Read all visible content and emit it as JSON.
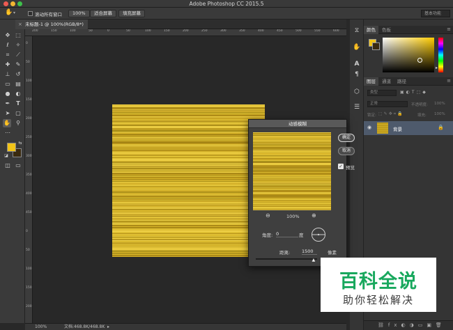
{
  "app": {
    "title": "Adobe Photoshop CC 2015.5"
  },
  "options_bar": {
    "scroll_all_label": "滚动所有窗口",
    "zoom_label": "100%",
    "fit_screen_label": "适合屏幕",
    "fill_screen_label": "填充屏幕",
    "workspace_label": "基本功能"
  },
  "document": {
    "tab_title": "未标题-1 @ 100%(RGB/8*)",
    "tab_close": "×"
  },
  "ruler": {
    "h_ticks": [
      "200",
      "150",
      "100",
      "50",
      "0",
      "50",
      "100",
      "150",
      "200",
      "250",
      "300",
      "350",
      "400",
      "450",
      "500",
      "550",
      "600"
    ]
  },
  "colors": {
    "foreground": "#f2c418",
    "background": "#3a2a10",
    "layer_highlight": "#4e5a6c",
    "watermark_green": "#18a85d"
  },
  "status": {
    "zoom": "100%",
    "doc_info": "文档:468.8K/468.8K"
  },
  "panels": {
    "color_tabs": [
      "颜色",
      "色板"
    ],
    "layer_tabs": [
      "图层",
      "通道",
      "路径"
    ],
    "kind_label": "类型",
    "blend_mode": "正常",
    "opacity_label": "不透明度:",
    "opacity_value": "100%",
    "lock_label": "锁定:",
    "fill_label": "填充:",
    "fill_value": "100%",
    "layer_name": "背景"
  },
  "dialog": {
    "title": "动感模糊",
    "ok_label": "确定",
    "cancel_label": "取消",
    "preview_label": "预览",
    "zoom_label": "100%",
    "angle_label": "角度:",
    "angle_value": "0",
    "angle_unit": "度",
    "distance_label": "距离:",
    "distance_value": "1500",
    "distance_unit": "像素",
    "distance_slider": 0.95
  },
  "watermark": {
    "title": "百科全说",
    "subtitle": "助你轻松解决"
  }
}
